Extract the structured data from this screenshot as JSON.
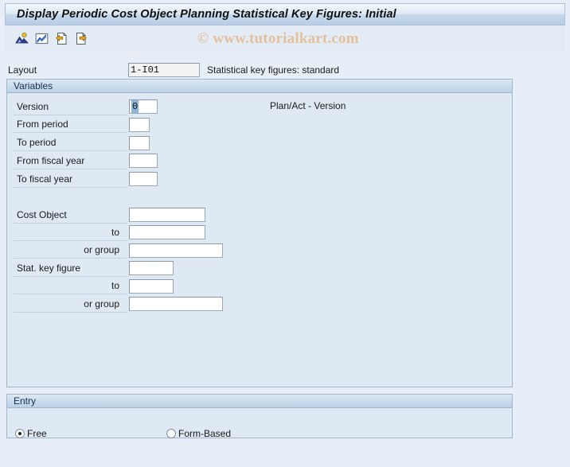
{
  "window": {
    "title": "Display Periodic Cost Object Planning Statistical Key Figures: Initial"
  },
  "toolbar": {
    "icons": [
      {
        "name": "selection-variant-icon",
        "title": "Selection variant"
      },
      {
        "name": "chart-icon",
        "title": "Report"
      },
      {
        "name": "import-page-icon",
        "title": "Previous screen"
      },
      {
        "name": "export-page-icon",
        "title": "Next screen"
      }
    ]
  },
  "watermark": {
    "text": "© www.tutorialkart.com"
  },
  "layout": {
    "label": "Layout",
    "value": "1-I01",
    "description": "Statistical key figures: standard"
  },
  "variables": {
    "header": "Variables",
    "fields": [
      {
        "label": "Version",
        "value": "0",
        "selected": true,
        "width": 36,
        "align": "left",
        "label_width": 143
      },
      {
        "label": "From period",
        "value": "",
        "width": 26,
        "align": "left",
        "label_width": 143
      },
      {
        "label": "To period",
        "value": "",
        "width": 26,
        "align": "left",
        "label_width": 143
      },
      {
        "label": "From fiscal year",
        "value": "",
        "width": 36,
        "align": "left",
        "label_width": 143
      },
      {
        "label": "To fiscal year",
        "value": "",
        "width": 36,
        "align": "left",
        "label_width": 143
      }
    ],
    "version_description": "Plan/Act - Version",
    "selection_fields": [
      {
        "label": "Cost Object",
        "value": "",
        "width": 96,
        "align": "left",
        "label_width": 143
      },
      {
        "label": "to",
        "value": "",
        "width": 96,
        "align": "right",
        "label_width": 143
      },
      {
        "label": "or group",
        "value": "",
        "width": 118,
        "align": "right",
        "label_width": 143
      },
      {
        "label": "Stat. key figure",
        "value": "",
        "width": 56,
        "align": "left",
        "label_width": 143
      },
      {
        "label": "to",
        "value": "",
        "width": 56,
        "align": "right",
        "label_width": 143
      },
      {
        "label": "or group",
        "value": "",
        "width": 118,
        "align": "right",
        "label_width": 143
      }
    ]
  },
  "entry": {
    "header": "Entry",
    "options": [
      {
        "label": "Free",
        "checked": true
      },
      {
        "label": "Form-Based",
        "checked": false
      }
    ]
  }
}
